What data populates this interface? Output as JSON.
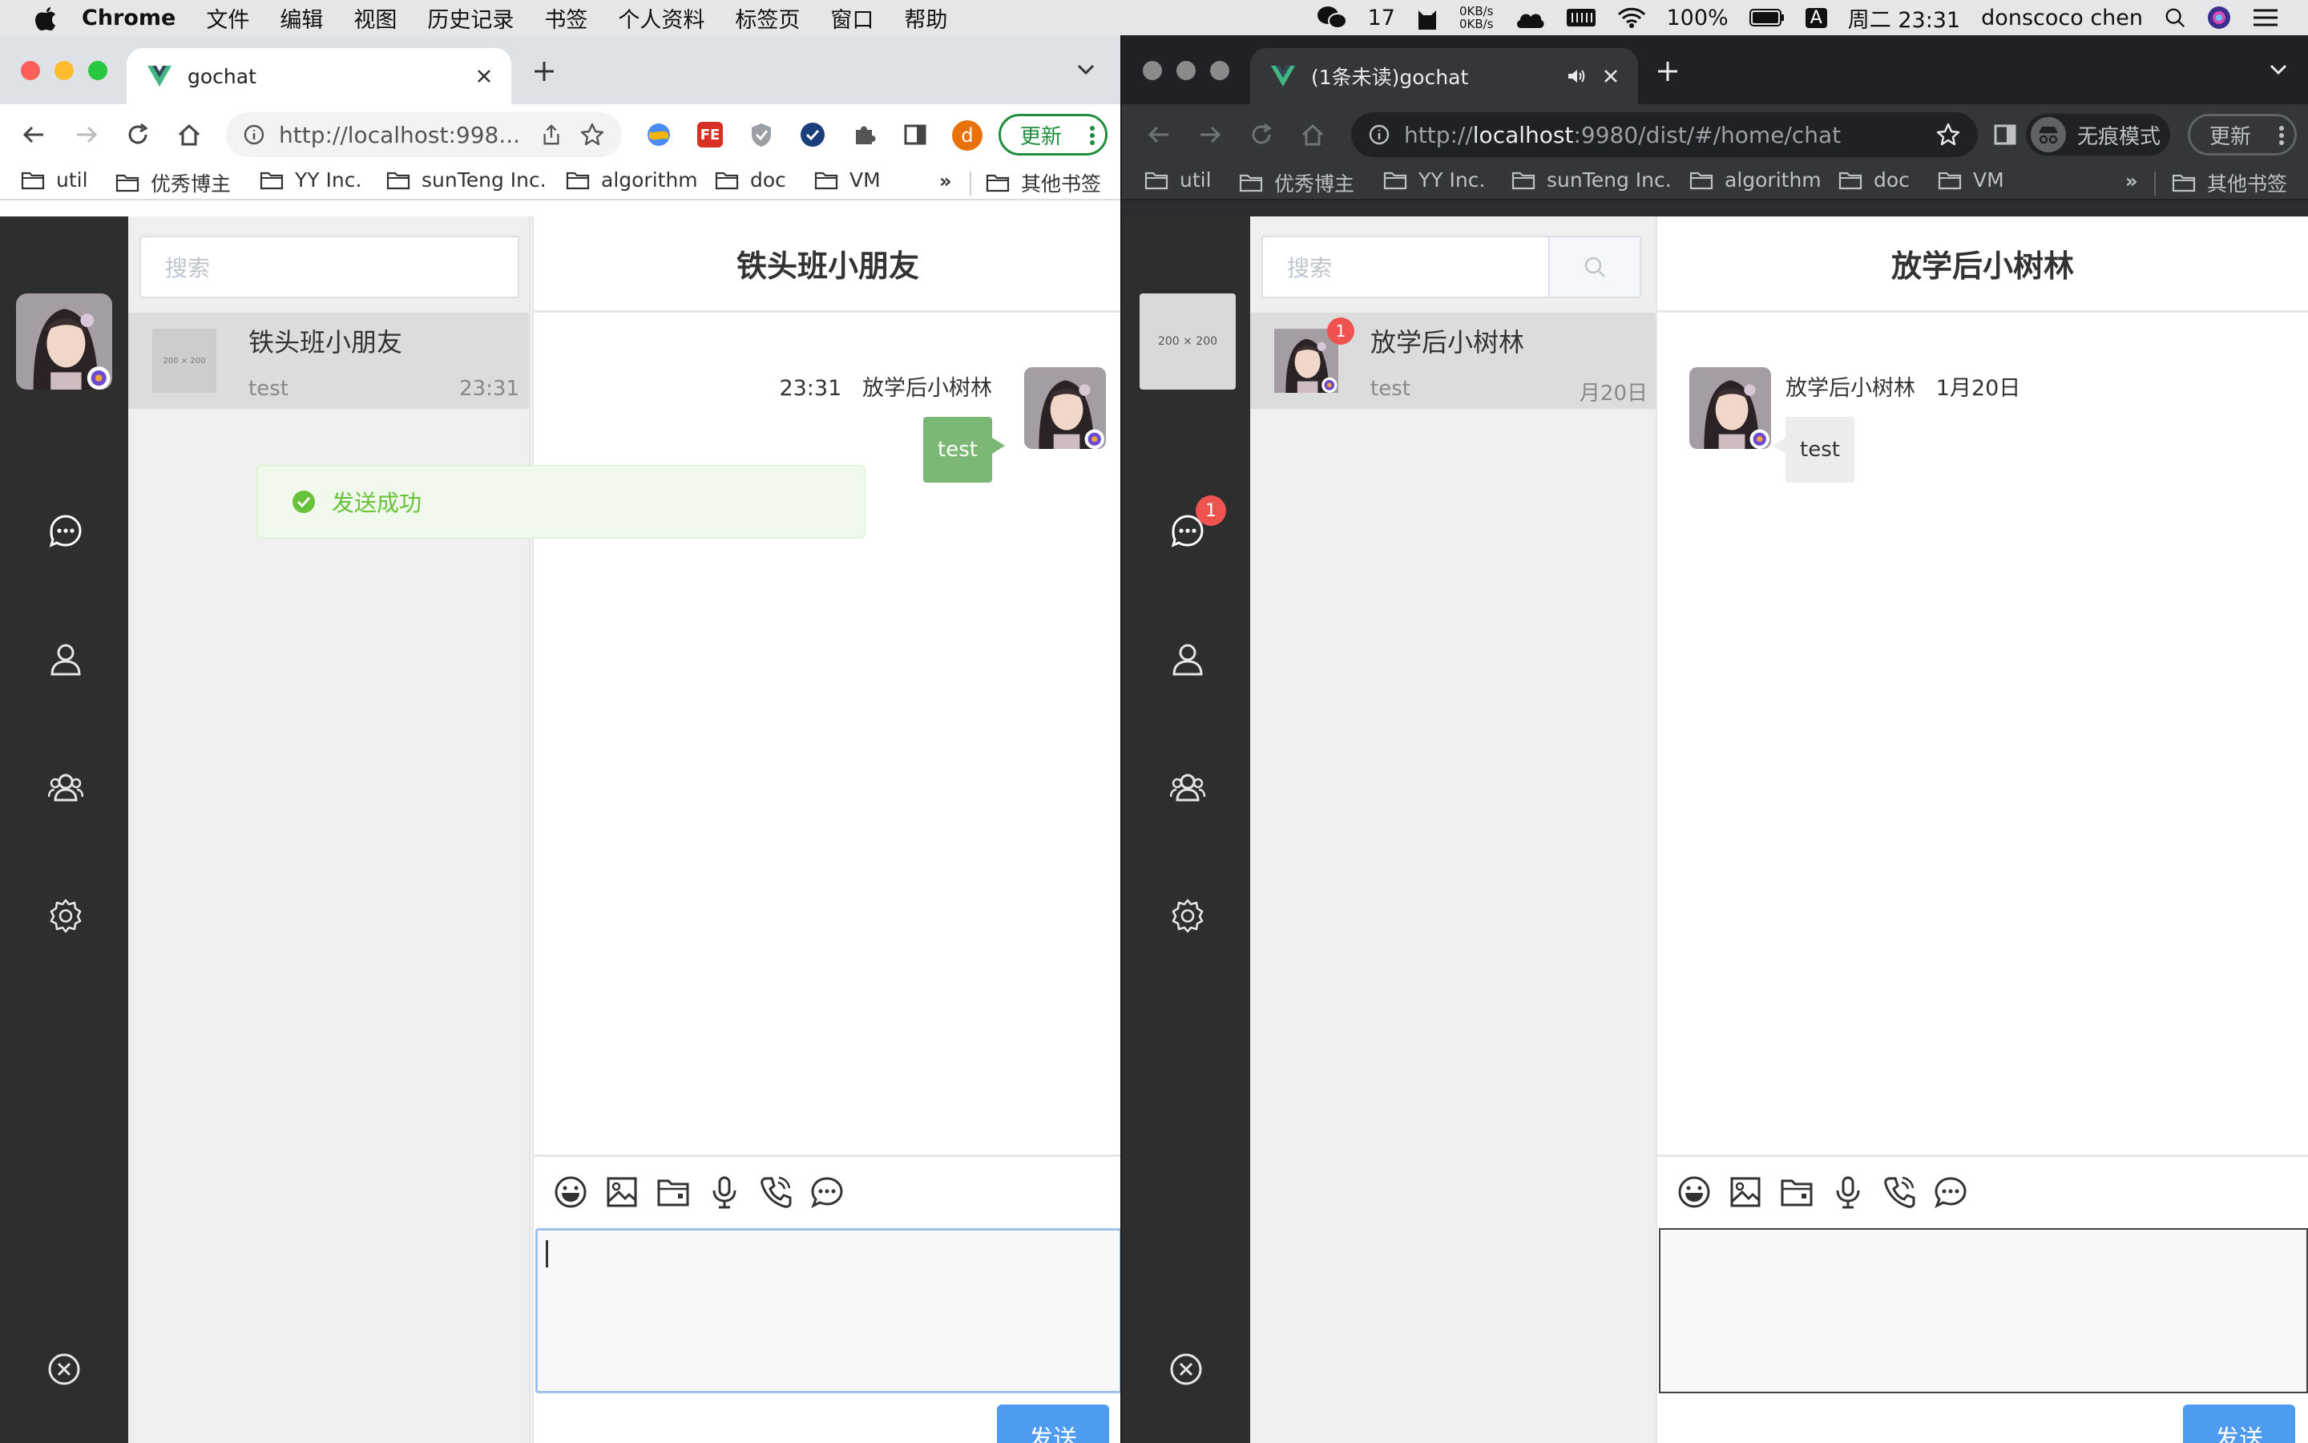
{
  "menubar": {
    "items": [
      "Chrome",
      "文件",
      "编辑",
      "视图",
      "历史记录",
      "书签",
      "个人资料",
      "标签页",
      "窗口",
      "帮助"
    ],
    "wechat_count": "17",
    "net_up": "0KB/s",
    "net_down": "0KB/s",
    "battery": "100%",
    "input_method": "A",
    "clock": "周二 23:31",
    "user": "donscoco chen"
  },
  "left_window": {
    "tab_title": "gochat",
    "url": "http://localhost:998...",
    "update_label": "更新",
    "profile_initial": "d",
    "bookmarks": [
      "util",
      "优秀博主",
      "YY Inc.",
      "sunTeng Inc.",
      "algorithm",
      "doc",
      "VM"
    ],
    "bookmarks_more": "»",
    "other_bookmarks": "其他书签",
    "app": {
      "search_placeholder": "搜索",
      "toast": "发送成功",
      "session": {
        "name": "铁头班小朋友",
        "last_message": "test",
        "time": "23:31",
        "avatar_placeholder": "200 × 200"
      },
      "chat_title": "铁头班小朋友",
      "message": {
        "time": "23:31",
        "sender": "放学后小树林",
        "text": "test"
      },
      "send_label": "发送"
    }
  },
  "right_window": {
    "tab_title": "(1条未读)gochat",
    "url_prefix": "http://",
    "url_host": "localhost",
    "url_rest": ":9980/dist/#/home/chat",
    "incognito_label": "无痕模式",
    "update_label": "更新",
    "bookmarks": [
      "util",
      "优秀博主",
      "YY Inc.",
      "sunTeng Inc.",
      "algorithm",
      "doc",
      "VM"
    ],
    "bookmarks_more": "»",
    "other_bookmarks": "其他书签",
    "app": {
      "search_placeholder": "搜索",
      "nav_avatar_placeholder": "200 × 200",
      "nav_chat_badge": "1",
      "session": {
        "name": "放学后小树林",
        "last_message": "test",
        "time": "月20日",
        "badge": "1"
      },
      "chat_title": "放学后小树林",
      "message": {
        "sender": "放学后小树林",
        "date": "1月20日",
        "text": "test"
      },
      "send_label": "发送"
    }
  },
  "colors": {
    "accent_send": "#4e9cf2",
    "my_bubble": "#7bb876",
    "badge": "#ef5350",
    "toast_text": "#67c23a",
    "nav_bg": "#2e2e2e"
  }
}
